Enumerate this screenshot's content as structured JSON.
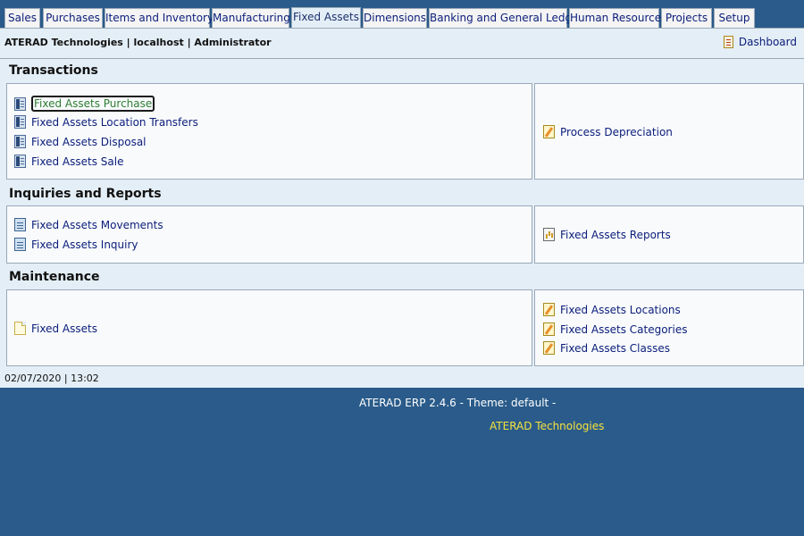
{
  "tabs": [
    {
      "label": "Sales",
      "active": false
    },
    {
      "label": "Purchases",
      "active": false
    },
    {
      "label": "Items and Inventory",
      "active": false
    },
    {
      "label": "Manufacturing",
      "active": false
    },
    {
      "label": "Fixed Assets",
      "active": true
    },
    {
      "label": "Dimensions",
      "active": false
    },
    {
      "label": "Banking and General Ledger",
      "active": false
    },
    {
      "label": "Human Resource",
      "active": false
    },
    {
      "label": "Projects",
      "active": false
    },
    {
      "label": "Setup",
      "active": false
    }
  ],
  "header": {
    "company_line": "ATERAD Technologies | localhost | Administrator",
    "dashboard_label": "Dashboard"
  },
  "sections": {
    "transactions": {
      "title": "Transactions",
      "left": [
        "Fixed Assets Purchase",
        "Fixed Assets Location Transfers",
        "Fixed Assets Disposal",
        "Fixed Assets Sale"
      ],
      "right": [
        "Process Depreciation"
      ]
    },
    "inquiries": {
      "title": "Inquiries and Reports",
      "left": [
        "Fixed Assets Movements",
        "Fixed Assets Inquiry"
      ],
      "right": [
        "Fixed Assets Reports"
      ]
    },
    "maintenance": {
      "title": "Maintenance",
      "left": [
        "Fixed Assets"
      ],
      "right": [
        "Fixed Assets Locations",
        "Fixed Assets Categories",
        "Fixed Assets Classes"
      ]
    }
  },
  "status": {
    "datetime": "02/07/2020 | 13:02"
  },
  "footer": {
    "version": "ATERAD ERP 2.4.6 - Theme: default -",
    "company": "ATERAD Technologies"
  },
  "colors": {
    "background": "#2a5b8a",
    "panel": "#e4eef6",
    "link": "#0b1d7a",
    "footer_company": "#f5e23c"
  }
}
